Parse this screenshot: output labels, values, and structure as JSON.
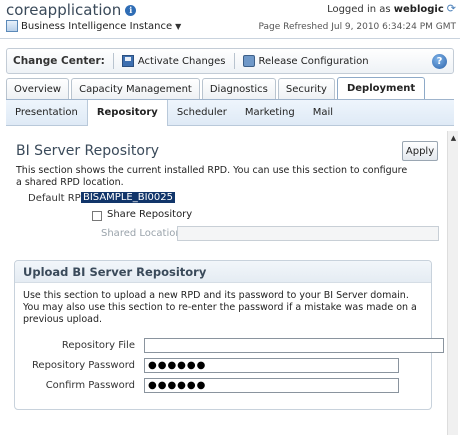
{
  "header": {
    "app_title": "coreapplication",
    "logged_in_prefix": "Logged in as",
    "username": "weblogic",
    "instance_label": "Business Intelligence Instance",
    "refreshed": "Page Refreshed Jul 9, 2010 6:34:24 PM GMT"
  },
  "change_center": {
    "title": "Change Center:",
    "activate": "Activate Changes",
    "release": "Release Configuration",
    "help": "?"
  },
  "tabs": [
    "Overview",
    "Capacity Management",
    "Diagnostics",
    "Security",
    "Deployment"
  ],
  "active_tab": "Deployment",
  "subtabs": [
    "Presentation",
    "Repository",
    "Scheduler",
    "Marketing",
    "Mail"
  ],
  "active_subtab": "Repository",
  "repository": {
    "title": "BI Server Repository",
    "apply": "Apply",
    "description": "This section shows the current installed RPD. You can use this section to configure a shared RPD location.",
    "default_rpd_label": "Default RPD",
    "default_rpd_value": "BISAMPLE_BI0025",
    "share_label": "Share Repository",
    "shared_location_label": "Shared Location",
    "shared_location_value": ""
  },
  "upload": {
    "title": "Upload BI Server Repository",
    "description": "Use this section to upload a new RPD and its password to your BI Server domain. You may also use this section to re-enter the password if a mistake was made on a previous upload.",
    "file_label": "Repository File",
    "file_value": "",
    "password_label": "Repository Password",
    "password_value": "●●●●●●",
    "confirm_label": "Confirm Password",
    "confirm_value": "●●●●●●"
  }
}
